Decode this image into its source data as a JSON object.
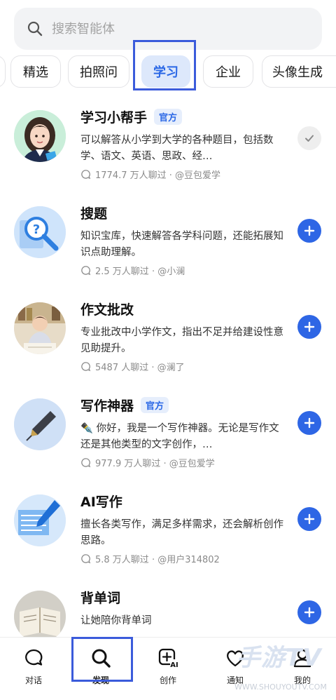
{
  "search": {
    "placeholder": "搜索智能体"
  },
  "tabs": [
    {
      "label": "精选"
    },
    {
      "label": "拍照问"
    },
    {
      "label": "学习"
    },
    {
      "label": "企业"
    },
    {
      "label": "头像生成"
    }
  ],
  "active_tab": "学习",
  "agents": [
    {
      "name": "学习小帮手",
      "badge": "官方",
      "desc": "可以解答从小学到大学的各种题目，包括数学、语文、英语、思政、经…",
      "stats": "1774.7 万人聊过 · @豆包爱学",
      "added": true,
      "avatar": "girl-avatar"
    },
    {
      "name": "搜题",
      "badge": "",
      "desc": "知识宝库，快速解答各学科问题，还能拓展知识点助理解。",
      "stats": "2.5 万人聊过 · @小澜",
      "added": false,
      "avatar": "magnifier-question-avatar"
    },
    {
      "name": "作文批改",
      "badge": "",
      "desc": "专业批改中小学作文，指出不足并给建设性意见助提升。",
      "stats": "5487 人聊过 · @澜了",
      "added": false,
      "avatar": "student-writing-avatar"
    },
    {
      "name": "写作神器",
      "badge": "官方",
      "desc": "✒️ 你好，我是一个写作神器。无论是写作文还是其他类型的文字创作，…",
      "stats": "977.9 万人聊过 · @豆包爱学",
      "added": false,
      "avatar": "fountain-pen-avatar"
    },
    {
      "name": "AI写作",
      "badge": "",
      "desc": "擅长各类写作，满足多样需求，还会解析创作思路。",
      "stats": "5.8 万人聊过 · @用户314802",
      "added": false,
      "avatar": "document-pen-avatar"
    },
    {
      "name": "背单词",
      "badge": "",
      "desc": "让她陪你背单词",
      "stats": "",
      "added": false,
      "avatar": "book-avatar"
    }
  ],
  "bottom_nav": [
    {
      "label": "对话",
      "icon": "chat-bubble-icon"
    },
    {
      "label": "发现",
      "icon": "search-icon"
    },
    {
      "label": "创作",
      "icon": "create-ai-icon"
    },
    {
      "label": "通知",
      "icon": "heart-icon"
    },
    {
      "label": "我的",
      "icon": "person-icon"
    }
  ],
  "active_nav": "发现",
  "colors": {
    "accent": "#2e66e5",
    "highlight_box": "#3b5bdb",
    "active_tab_bg": "#dde8fb"
  },
  "watermark": {
    "logo": "手游TV",
    "url": "WWW.SHOUYOUTV.COM"
  }
}
